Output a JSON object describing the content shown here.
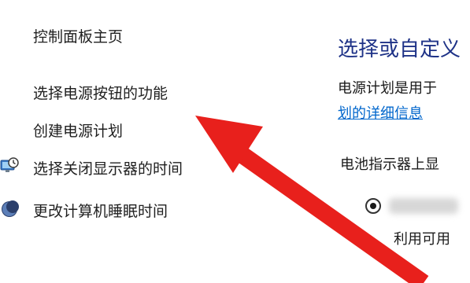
{
  "sidebar": {
    "home_link": "控制面板主页",
    "items": [
      {
        "label": "选择电源按钮的功能",
        "icon": null
      },
      {
        "label": "创建电源计划",
        "icon": null
      },
      {
        "label": "选择关闭显示器的时间",
        "icon": "display-clock-icon"
      },
      {
        "label": "更改计算机睡眠时间",
        "icon": "moon-sleep-icon"
      }
    ]
  },
  "main": {
    "title": "选择或自定义",
    "description": "电源计划是用于",
    "details_link": "划的详细信息",
    "battery_meter_label": "电池指示器上显",
    "plan_option_sub": "利用可用"
  },
  "colors": {
    "title": "#1e3287",
    "link": "#0066cc",
    "annotation_arrow": "#e8201c"
  }
}
